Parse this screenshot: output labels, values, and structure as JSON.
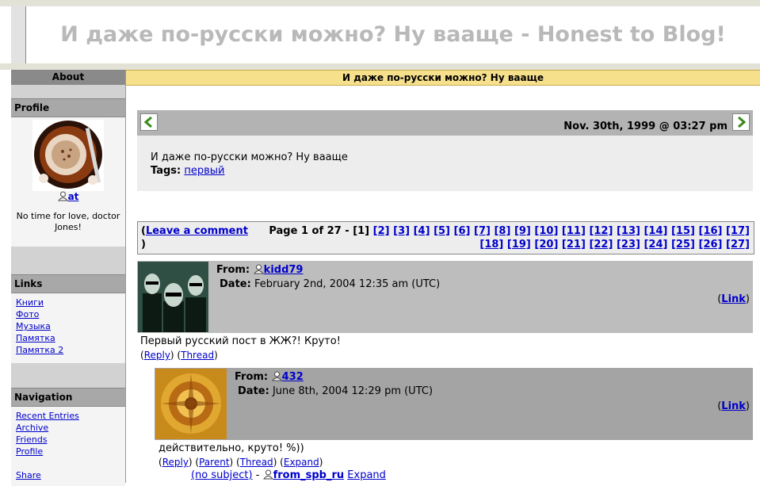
{
  "header": {
    "title": "И даже по-русски можно? Ну вааще - Honest to Blog!"
  },
  "sidebar": {
    "about": "About",
    "profile_heading": "Profile",
    "user": "at",
    "tagline": "No time for love, doctor Jones!",
    "links_heading": "Links",
    "links": [
      "Книги",
      "Фото",
      "Музыка",
      "Памятка",
      "Памятка 2"
    ],
    "navigation_heading": "Navigation",
    "nav": [
      "Recent Entries",
      "Archive",
      "Friends",
      "Profile"
    ],
    "share": "Share"
  },
  "entry": {
    "subject": "И даже по-русски можно? Ну вааще",
    "date": "Nov. 30th, 1999 @ 03:27 pm",
    "text": "И даже по-русски можно? Ну вааще",
    "tags_label": "Tags:",
    "tag": "первый"
  },
  "pager": {
    "leave_open": "(",
    "leave_comment": "Leave a comment",
    "leave_close": ")",
    "page_label": "Page 1 of 27 -",
    "current": "[1]",
    "pages": [
      "[2]",
      "[3]",
      "[4]",
      "[5]",
      "[6]",
      "[7]",
      "[8]",
      "[9]",
      "[10]",
      "[11]",
      "[12]",
      "[13]",
      "[14]",
      "[15]",
      "[16]",
      "[17]",
      "[18]",
      "[19]",
      "[20]",
      "[21]",
      "[22]",
      "[23]",
      "[24]",
      "[25]",
      "[26]",
      "[27]"
    ]
  },
  "comments": [
    {
      "from_label": "From:",
      "user": "kidd79",
      "date_label": "Date:",
      "date": "February 2nd, 2004 12:35 am (UTC)",
      "link": "Link",
      "text": "Первый русский пост в ЖЖ?! Круто!",
      "actions": [
        "Reply",
        "Thread"
      ]
    },
    {
      "from_label": "From:",
      "user": "432",
      "date_label": "Date:",
      "date": "June 8th, 2004 12:29 pm (UTC)",
      "link": "Link",
      "text": "действительно, круто! %))",
      "actions": [
        "Reply",
        "Parent",
        "Thread",
        "Expand"
      ]
    }
  ],
  "collapsed": {
    "subject": "(no subject)",
    "sep": "-",
    "user": "from_spb_ru",
    "expand": "Expand"
  }
}
